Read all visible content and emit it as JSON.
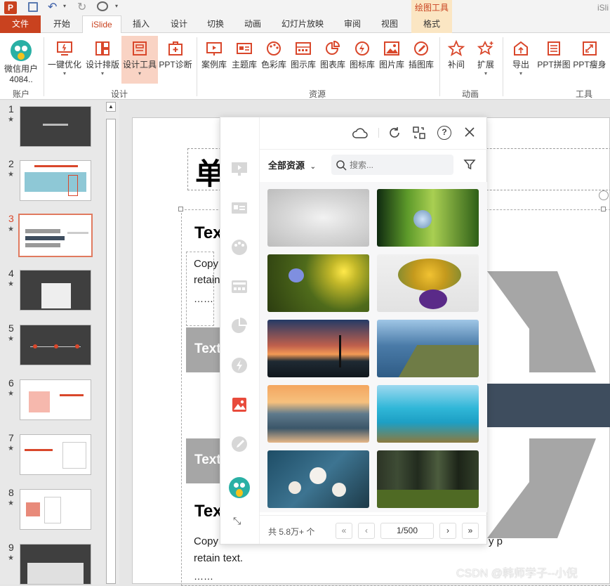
{
  "titlebar": {
    "app_icon": "powerpoint-icon",
    "right_text": "iSli"
  },
  "tabs": [
    "文件",
    "开始",
    "iSlide",
    "插入",
    "设计",
    "切换",
    "动画",
    "幻灯片放映",
    "审阅",
    "视图",
    "格式"
  ],
  "context_tab_header": "绘图工具",
  "ribbon": {
    "account": {
      "name": "微信用户",
      "id": "4084..",
      "group": "账户"
    },
    "design_buttons": [
      "一键优化",
      "设计排版",
      "设计工具",
      "PPT诊断"
    ],
    "design_group": "设计",
    "resource_buttons": [
      "案例库",
      "主题库",
      "色彩库",
      "图示库",
      "图表库",
      "图标库",
      "图片库",
      "插图库"
    ],
    "resource_group": "资源",
    "animation_buttons": [
      "补间",
      "扩展"
    ],
    "animation_group": "动画",
    "tool_buttons": [
      "导出",
      "PPT拼图",
      "PPT瘦身"
    ],
    "tool_group": "工具"
  },
  "slides": [
    {
      "num": "1",
      "star": "★"
    },
    {
      "num": "2",
      "star": "★"
    },
    {
      "num": "3",
      "star": "★"
    },
    {
      "num": "4",
      "star": "★"
    },
    {
      "num": "5",
      "star": "★"
    },
    {
      "num": "6",
      "star": "★"
    },
    {
      "num": "7",
      "star": "★"
    },
    {
      "num": "8",
      "star": "★"
    },
    {
      "num": "9",
      "star": "★"
    }
  ],
  "slide": {
    "title_char": "单",
    "heading1": "Tex",
    "body1_line1": "Copy",
    "body1_line2": "retain",
    "ellipsis1": "……",
    "band1": "Text",
    "band2": "Text",
    "heading2": "Tex",
    "body2_line1": "Copy",
    "body2_line1_tail": "y p",
    "body2_line2": "retain text.",
    "ellipsis2": "……"
  },
  "panel": {
    "resource_filter": "全部资源",
    "search_placeholder": "搜索...",
    "total": "共 5.8万+ 个",
    "page": "1/500",
    "first_label": "«",
    "prev_label": "‹",
    "next_label": "›",
    "last_label": "»"
  },
  "watermark": "CSDN @韩师学子--小倪"
}
